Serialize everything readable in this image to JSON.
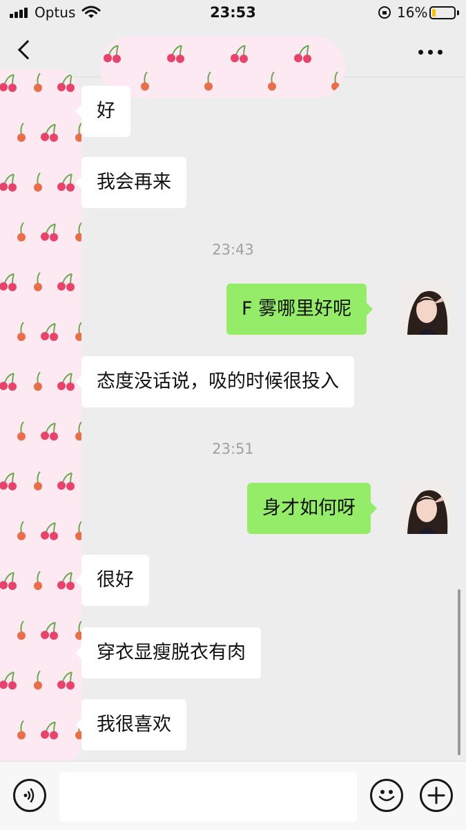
{
  "status_bar": {
    "carrier": "Optus",
    "time": "23:53",
    "battery_percent": "16%",
    "battery_level": 0.16,
    "icons": [
      "cellular-signal-icon",
      "wifi-icon",
      "rotation-lock-icon",
      "battery-icon"
    ]
  },
  "nav": {
    "back_icon": "chevron-left-icon",
    "title_sticker": "cherry-pattern-sticker",
    "more_icon": "more-dots-icon"
  },
  "messages": [
    {
      "type": "in",
      "text": "好"
    },
    {
      "type": "in",
      "text": "我会再来"
    },
    {
      "type": "time",
      "text": "23:43"
    },
    {
      "type": "out",
      "text": "F 雾哪里好呢"
    },
    {
      "type": "in",
      "text": "态度没话说，吸的时候很投入"
    },
    {
      "type": "time",
      "text": "23:51"
    },
    {
      "type": "out",
      "text": "身才如何呀"
    },
    {
      "type": "in",
      "text": "很好"
    },
    {
      "type": "in",
      "text": "穿衣显瘦脱衣有肉"
    },
    {
      "type": "in",
      "text": "我很喜欢"
    }
  ],
  "input_bar": {
    "text_value": "",
    "icons": [
      "voice-icon",
      "emoji-icon",
      "plus-icon"
    ]
  },
  "colors": {
    "background": "#ededed",
    "outgoing_bubble": "#95ec69",
    "incoming_bubble": "#ffffff",
    "sticker_pink": "#fde9f1",
    "cherry_red": "#e8436b",
    "battery_yellow": "#f7c300"
  }
}
